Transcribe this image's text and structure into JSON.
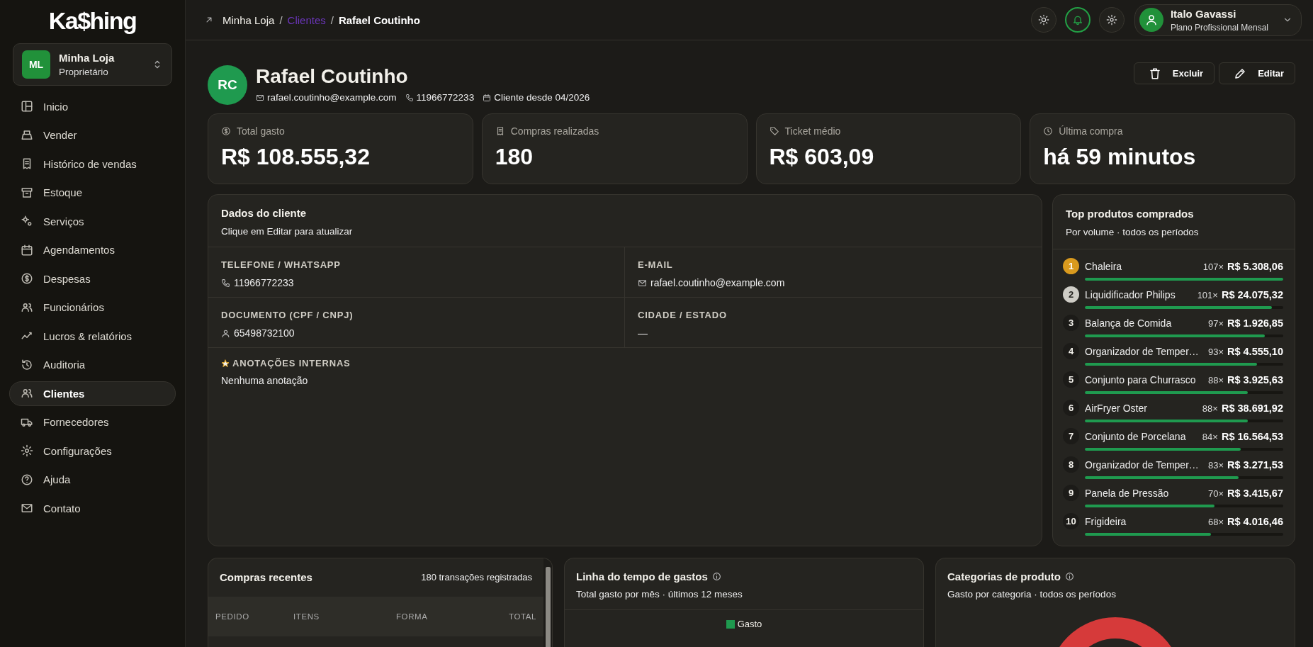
{
  "sidebar": {
    "logo": "Ka$hing",
    "store": {
      "initials": "ML",
      "name": "Minha Loja",
      "role": "Proprietário"
    },
    "items": [
      {
        "label": "Inicio",
        "selected": false
      },
      {
        "label": "Vender",
        "selected": false
      },
      {
        "label": "Histórico de vendas",
        "selected": false
      },
      {
        "label": "Estoque",
        "selected": false
      },
      {
        "label": "Serviços",
        "selected": false
      },
      {
        "label": "Agendamentos",
        "selected": false
      },
      {
        "label": "Despesas",
        "selected": false
      },
      {
        "label": "Funcionários",
        "selected": false
      },
      {
        "label": "Lucros & relatórios",
        "selected": false
      },
      {
        "label": "Auditoria",
        "selected": false
      },
      {
        "label": "Clientes",
        "selected": true
      },
      {
        "label": "Fornecedores",
        "selected": false
      },
      {
        "label": "Configurações",
        "selected": false
      },
      {
        "label": "Ajuda",
        "selected": false
      },
      {
        "label": "Contato",
        "selected": false
      }
    ]
  },
  "topbar": {
    "separator": "/",
    "breadcrumb": [
      {
        "label": "Minha Loja",
        "kind": "plain"
      },
      {
        "label": "Clientes",
        "kind": "link"
      },
      {
        "label": "Rafael Coutinho",
        "kind": "current"
      }
    ],
    "user": {
      "name": "Italo Gavassi",
      "plan": "Plano Profissional Mensal"
    }
  },
  "client": {
    "initials": "RC",
    "name": "Rafael Coutinho",
    "email": "rafael.coutinho@example.com",
    "phone": "11966772233",
    "since": "Cliente desde 04/2026",
    "actions": [
      {
        "label": "Excluir",
        "kind": "delete"
      },
      {
        "label": "Editar",
        "kind": "edit"
      }
    ]
  },
  "stats": [
    {
      "label": "Total gasto",
      "value": "R$ 108.555,32"
    },
    {
      "label": "Compras realizadas",
      "value": "180"
    },
    {
      "label": "Ticket médio",
      "value": "R$ 603,09"
    },
    {
      "label": "Última compra",
      "value": "há 59 minutos"
    }
  ],
  "details": {
    "title": "Dados do cliente",
    "subtitle": "Clique em Editar para atualizar",
    "fields": [
      {
        "label": "TELEFONE / WHATSAPP",
        "value": "11966772233",
        "kind": "phone"
      },
      {
        "label": "E-MAIL",
        "value": "rafael.coutinho@example.com",
        "kind": "email"
      },
      {
        "label": "DOCUMENTO (CPF / CNPJ)",
        "value": "65498732100",
        "kind": "document"
      },
      {
        "label": "CIDADE / ESTADO",
        "value": "—",
        "kind": "plain"
      }
    ],
    "notes": {
      "label": "ANOTAÇÕES INTERNAS",
      "text": "Nenhuma anotação"
    }
  },
  "top_products": {
    "title": "Top produtos comprados",
    "subtitle": "Por volume · todos os períodos",
    "items": [
      {
        "rank": "1",
        "kind": "gold",
        "name": "Chaleira",
        "count": "107×",
        "total": "R$ 5.308,06",
        "level": 1.0
      },
      {
        "rank": "2",
        "kind": "silver",
        "name": "Liquidificador Philips",
        "count": "101×",
        "total": "R$ 24.075,32",
        "level": 0.944
      },
      {
        "rank": "3",
        "kind": "plain",
        "name": "Balança de Comida",
        "count": "97×",
        "total": "R$ 1.926,85",
        "level": 0.906
      },
      {
        "rank": "4",
        "kind": "plain",
        "name": "Organizador de Temper…",
        "count": "93×",
        "total": "R$ 4.555,10",
        "level": 0.869
      },
      {
        "rank": "5",
        "kind": "plain",
        "name": "Conjunto para Churrasco",
        "count": "88×",
        "total": "R$ 3.925,63",
        "level": 0.822
      },
      {
        "rank": "6",
        "kind": "plain",
        "name": "AirFryer Oster",
        "count": "88×",
        "total": "R$ 38.691,92",
        "level": 0.822
      },
      {
        "rank": "7",
        "kind": "plain",
        "name": "Conjunto de Porcelana",
        "count": "84×",
        "total": "R$ 16.564,53",
        "level": 0.785
      },
      {
        "rank": "8",
        "kind": "plain",
        "name": "Organizador de Temper…",
        "count": "83×",
        "total": "R$ 3.271,53",
        "level": 0.776
      },
      {
        "rank": "9",
        "kind": "plain",
        "name": "Panela de Pressão",
        "count": "70×",
        "total": "R$ 3.415,67",
        "level": 0.654
      },
      {
        "rank": "10",
        "kind": "plain",
        "name": "Frigideira",
        "count": "68×",
        "total": "R$ 4.016,46",
        "level": 0.636
      }
    ]
  },
  "recent_purchases": {
    "title": "Compras recentes",
    "count": "180 transações registradas",
    "columns": [
      "PEDIDO",
      "ITENS",
      "FORMA",
      "TOTAL"
    ]
  },
  "spending_timeline": {
    "title": "Linha do tempo de gastos",
    "subtitle": "Total gasto por mês · últimos 12 meses",
    "legend": "Gasto"
  },
  "product_categories": {
    "title": "Categorias de produto",
    "subtitle": "Gasto por categoria · todos os períodos"
  }
}
